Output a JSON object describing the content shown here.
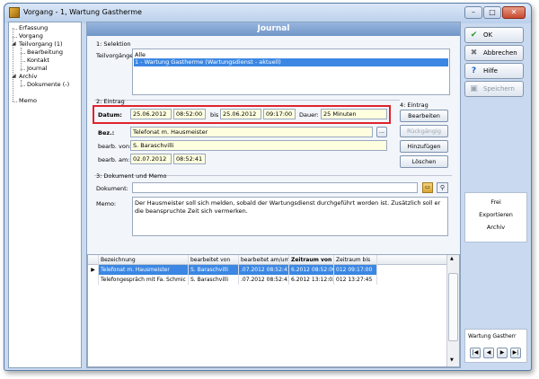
{
  "window": {
    "title": "Vorgang - 1, Wartung Gastherme"
  },
  "tree": {
    "items": [
      "Erfassung",
      "Vorgang",
      "Teilvorgang (1)",
      "Bearbeitung",
      "Kontakt",
      "Journal",
      "Archiv",
      "Dokumente (-)",
      "Memo"
    ]
  },
  "journal": {
    "header": "Journal",
    "selektion_label": "1: Selektion",
    "teilvorgaenge_label": "Teilvorgänge:",
    "teilvorgaenge_items": [
      "Alle",
      "1 - Wartung Gastherme (Wartungsdienst - aktuell)"
    ],
    "eintrag2_label": "2: Eintrag",
    "datum_label": "Datum:",
    "datum_from": "25.06.2012",
    "time_from": "08:52:00",
    "bis_label": "bis",
    "datum_to": "25.06.2012",
    "time_to": "09:17:00",
    "dauer_label": "Dauer:",
    "dauer_value": "25 Minuten",
    "bez_label": "Bez.:",
    "bez_value": "Telefonat m. Hausmeister",
    "bez_button": "...",
    "bearb_von_label": "bearb. von:",
    "bearb_von_value": "S. Baraschvilli",
    "bearb_am_label": "bearb. am:",
    "bearb_am_date": "02.07.2012",
    "bearb_am_time": "08:52:41",
    "eintrag4_label": "4: Eintrag",
    "btn_bearbeiten": "Bearbeiten",
    "btn_rueckgaengig": "Rückgängig",
    "btn_hinzufuegen": "Hinzufügen",
    "btn_loeschen": "Löschen",
    "dokmemo_label": "3: Dokument und Memo",
    "dokument_label": "Dokument:",
    "memo_label": "Memo:",
    "memo_text": "Der Hausmeister soll sich melden, sobald der Wartungsdienst durchgeführt worden ist. Zusätzlich soll er die beanspruchte Zeit sich vermerken."
  },
  "grid": {
    "columns": [
      "Bezeichnung",
      "bearbeitet von",
      "bearbeitet am/um",
      "Zeitraum von",
      "Zeitraum bis"
    ],
    "rows": [
      [
        "Telefonat m. Hausmeister",
        "S. Baraschvilli",
        ".07.2012 08:52:41",
        "6.2012 08:52:00",
        "012 09:17:00"
      ],
      [
        "Telefongespräch mit Fa. Schmic",
        "S. Baraschvilli",
        ".07.2012 08:52:41",
        "6.2012 13:12:03",
        "012 13:27:45"
      ]
    ]
  },
  "right_panel": {
    "ok": "OK",
    "abbrechen": "Abbrechen",
    "hilfe": "Hilfe",
    "speichern": "Speichern",
    "frei": "Frei",
    "exportieren": "Exportieren",
    "archiv": "Archiv",
    "nav_label": "Wartung Gastherr"
  }
}
